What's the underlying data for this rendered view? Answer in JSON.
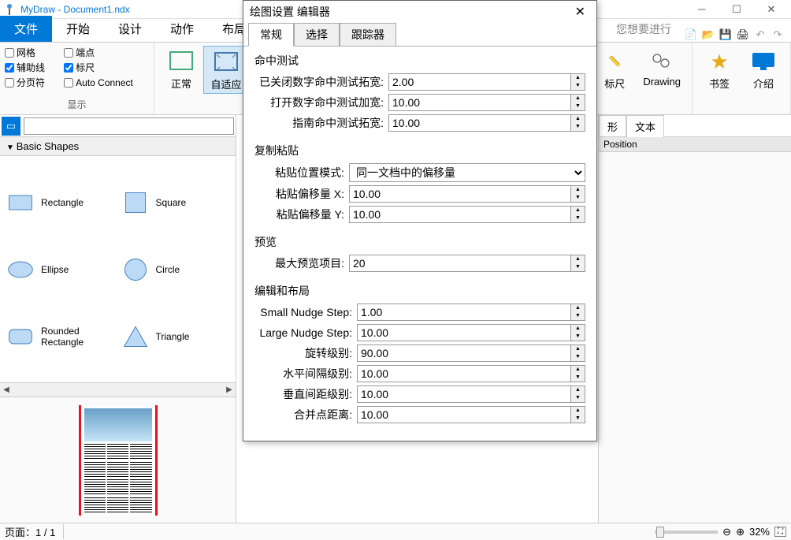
{
  "title": "MyDraw - Document1.ndx",
  "menu": {
    "file": "文件",
    "items": [
      "开始",
      "设计",
      "动作",
      "布局"
    ],
    "wish": "您想要进行"
  },
  "ribbon": {
    "checks": {
      "grid": "网格",
      "endpoint": "端点",
      "guide": "辅助线",
      "ruler": "标尺",
      "page_break": "分页符",
      "auto_connect": "Auto Connect",
      "grid_checked": false,
      "endpoint_checked": false,
      "guide_checked": true,
      "ruler_checked": true,
      "page_break_checked": false,
      "auto_connect_checked": false
    },
    "display_label": "显示",
    "normal": "正常",
    "fit": "自适应",
    "slice": "标尺",
    "drawing": "Drawing",
    "bookmark": "书签",
    "intro": "介绍"
  },
  "shapes": {
    "header": "Basic Shapes",
    "items": [
      {
        "name": "Rectangle"
      },
      {
        "name": "Square"
      },
      {
        "name": "Ellipse"
      },
      {
        "name": "Circle"
      },
      {
        "name": "Rounded Rectangle"
      },
      {
        "name": "Triangle"
      }
    ]
  },
  "right_panel": {
    "tab_shape": "形",
    "tab_text": "文本",
    "position": "Position"
  },
  "status": {
    "page_label": "页面：",
    "page": "1 / 1",
    "zoom": "32%"
  },
  "dialog": {
    "title": "绘图设置 编辑器",
    "tabs": [
      "常规",
      "选择",
      "跟踪器"
    ],
    "section1": {
      "title": "命中测试",
      "closed_hit_label": "已关闭数字命中测试拓宽:",
      "closed_hit": "2.00",
      "open_hit_label": "打开数字命中测试加宽:",
      "open_hit": "10.00",
      "guide_hit_label": "指南命中测试拓宽:",
      "guide_hit": "10.00"
    },
    "section2": {
      "title": "复制粘贴",
      "mode_label": "粘贴位置模式:",
      "mode_value": "同一文档中的偏移量",
      "offset_x_label": "粘贴偏移量 X:",
      "offset_x": "10.00",
      "offset_y_label": "粘贴偏移量 Y:",
      "offset_y": "10.00"
    },
    "section3": {
      "title": "预览",
      "max_label": "最大预览项目:",
      "max_value": "20"
    },
    "section4": {
      "title": "编辑和布局",
      "small_nudge_label": "Small Nudge Step:",
      "small_nudge": "1.00",
      "large_nudge_label": "Large Nudge Step:",
      "large_nudge": "10.00",
      "rotate_label": "旋转级别:",
      "rotate": "90.00",
      "hspace_label": "水平间隔级别:",
      "hspace": "10.00",
      "vspace_label": "垂直间距级别:",
      "vspace": "10.00",
      "merge_label": "合并点距离:",
      "merge": "10.00"
    }
  }
}
